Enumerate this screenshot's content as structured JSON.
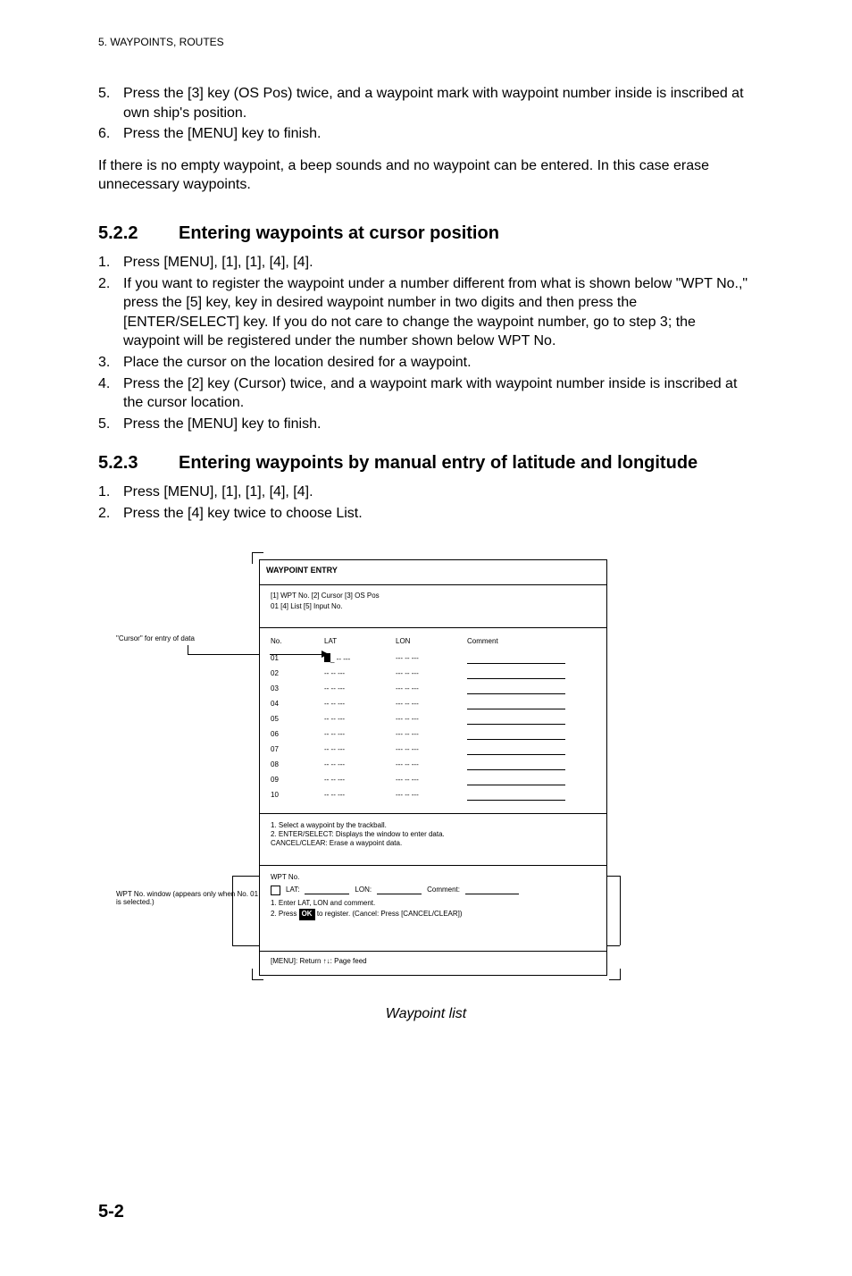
{
  "running_head": "5. WAYPOINTS, ROUTES",
  "list1": {
    "items": [
      {
        "n": "5.",
        "t": "Press the [3] key (OS Pos) twice, and a waypoint mark with waypoint number inside is inscribed at own ship's position."
      },
      {
        "n": "6.",
        "t": "Press the [MENU] key to finish."
      }
    ]
  },
  "para1": "If there is no empty waypoint, a beep sounds and no waypoint can be entered. In this case erase unnecessary waypoints.",
  "sec522": {
    "num": "5.2.2",
    "title": "Entering waypoints at cursor position"
  },
  "list2": {
    "items": [
      {
        "n": "1.",
        "t": "Press [MENU], [1], [1], [4], [4]."
      },
      {
        "n": "2.",
        "t": "If you want to register the waypoint under a number different from what is shown below \"WPT No.,\" press the [5] key, key in desired waypoint number in two digits and then press the [ENTER/SELECT] key. If you do not care to change the waypoint number, go to step 3; the waypoint will be registered under the number shown below WPT No."
      },
      {
        "n": "3.",
        "t": "Place the cursor on the location desired for a waypoint."
      },
      {
        "n": "4.",
        "t": "Press the [2] key (Cursor) twice, and a waypoint mark with waypoint number inside is inscribed at the cursor location."
      },
      {
        "n": "5.",
        "t": "Press the [MENU] key to finish."
      }
    ]
  },
  "sec523": {
    "num": "5.2.3",
    "title": "Entering waypoints by manual entry of latitude and longitude"
  },
  "list3": {
    "items": [
      {
        "n": "1.",
        "t": "Press [MENU], [1], [1], [4], [4]."
      },
      {
        "n": "2.",
        "t": "Press the [4] key twice to choose List."
      }
    ]
  },
  "figure": {
    "outer_title": "WAYPOINT ENTRY",
    "title_lines": [
      "[1] WPT No.           [2] Cursor           [3] OS Pos",
      "01                        [4]  List              [5]  Input No."
    ],
    "headers": [
      "No.",
      "LAT",
      "LON",
      "Comment"
    ],
    "rows": [
      {
        "no": "01",
        "lat_cursor": true
      },
      {
        "no": "02"
      },
      {
        "no": "03"
      },
      {
        "no": "04"
      },
      {
        "no": "05"
      },
      {
        "no": "06"
      },
      {
        "no": "07"
      },
      {
        "no": "08"
      },
      {
        "no": "09"
      },
      {
        "no": "10"
      }
    ],
    "lat_placeholder": "_ -- ---",
    "lon_placeholder": "--- -- ---",
    "lat_placeholder_plain": "-- -- ---",
    "msg_lines": [
      "1. Select a waypoint by the trackball.",
      "2. ENTER/SELECT: Displays the window to enter data.",
      "    CANCEL/CLEAR: Erase a waypoint data."
    ],
    "input_head": "WPT No.",
    "input_lines": [
      "1. Enter LAT, LON and comment.",
      "2. Press           to register. (Cancel: Press [CANCEL/CLEAR])"
    ],
    "ok_label": "OK",
    "foot": "[MENU]: Return          ↑↓: Page feed",
    "callout_cursor": "\"Cursor\" for entry of data",
    "callout_window": "WPT No. window (appears only when No. 01 is selected.)",
    "caption": "Waypoint list"
  },
  "page_number": "5-2"
}
